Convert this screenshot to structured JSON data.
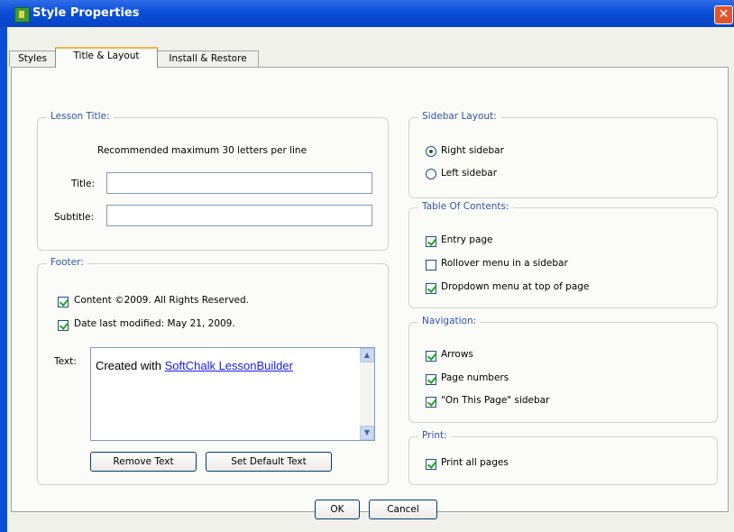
{
  "window": {
    "title": "Style Properties",
    "close_label": "✕"
  },
  "tabs": [
    {
      "label": "Styles",
      "active": false
    },
    {
      "label": "Title & Layout",
      "active": true
    },
    {
      "label": "Install & Restore",
      "active": false
    }
  ],
  "lesson_title": {
    "legend": "Lesson Title:",
    "hint": "Recommended maximum 30 letters per line",
    "title_label": "Title:",
    "title_value": "",
    "subtitle_label": "Subtitle:",
    "subtitle_value": ""
  },
  "footer": {
    "legend": "Footer:",
    "content_label": "Content ©2009. All Rights Reserved.",
    "content_checked": true,
    "date_label": "Date last modified: May 21, 2009.",
    "date_checked": true,
    "text_label": "Text:",
    "text_prefix": "Created with ",
    "text_link": "SoftChalk LessonBuilder",
    "remove_button": "Remove Text",
    "default_button": "Set Default Text"
  },
  "sidebar_layout": {
    "legend": "Sidebar Layout:",
    "right_label": "Right sidebar",
    "left_label": "Left sidebar",
    "selected": "right"
  },
  "toc": {
    "legend": "Table Of Contents:",
    "items": [
      {
        "label": "Entry page",
        "checked": true
      },
      {
        "label": "Rollover menu in a sidebar",
        "checked": false
      },
      {
        "label": "Dropdown menu at top of page",
        "checked": true
      }
    ]
  },
  "navigation": {
    "legend": "Navigation:",
    "items": [
      {
        "label": "Arrows",
        "checked": true
      },
      {
        "label": "Page numbers",
        "checked": true
      },
      {
        "label": "\"On This Page\" sidebar",
        "checked": true
      }
    ]
  },
  "print": {
    "legend": "Print:",
    "items": [
      {
        "label": "Print all pages",
        "checked": true
      }
    ]
  },
  "buttons": {
    "ok": "OK",
    "cancel": "Cancel"
  },
  "colors": {
    "titlebar": "#0a4fd8",
    "legend_text": "#2e56a8",
    "link": "#1a1aee",
    "check": "#21a121"
  },
  "icons": [
    "app-icon",
    "close-icon",
    "scroll-up-icon",
    "scroll-down-icon",
    "checkmark-icon",
    "radio-dot-icon"
  ]
}
